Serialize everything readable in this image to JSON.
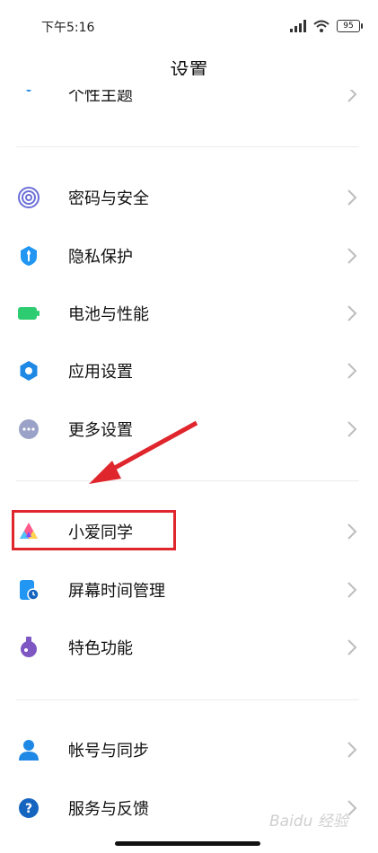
{
  "status_bar": {
    "time": "下午5:16",
    "battery": "95"
  },
  "header": {
    "title": "设置"
  },
  "partial_item": {
    "label": "个性主题"
  },
  "items": [
    {
      "label": "密码与安全",
      "icon": "fingerprint-icon"
    },
    {
      "label": "隐私保护",
      "icon": "privacy-shield-icon"
    },
    {
      "label": "电池与性能",
      "icon": "battery-icon"
    },
    {
      "label": "应用设置",
      "icon": "app-settings-gear-icon"
    },
    {
      "label": "更多设置",
      "icon": "more-dots-icon"
    },
    {
      "label": "小爱同学",
      "icon": "xiaoai-assistant-icon"
    },
    {
      "label": "屏幕时间管理",
      "icon": "screen-time-icon"
    },
    {
      "label": "特色功能",
      "icon": "flask-icon"
    },
    {
      "label": "帐号与同步",
      "icon": "account-person-icon"
    },
    {
      "label": "服务与反馈",
      "icon": "help-question-icon"
    }
  ],
  "watermark": "Baidu 经验",
  "colors": {
    "highlight": "#e0262d",
    "accent": "#1e88e5"
  }
}
